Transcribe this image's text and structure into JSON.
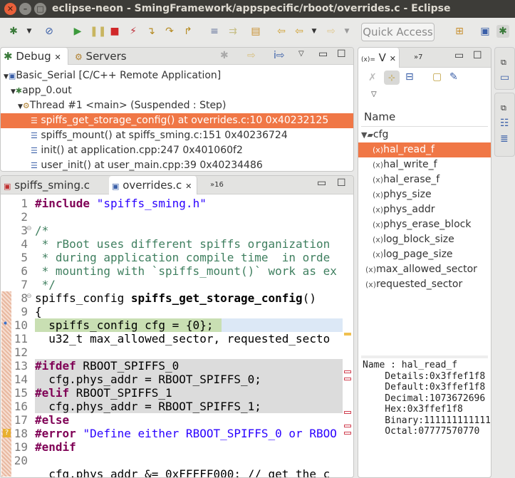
{
  "window": {
    "title": "eclipse-neon - SmingFramework/appspecific/rboot/overrides.c - Eclipse"
  },
  "toolbar": {
    "quick_access": "Quick Access"
  },
  "debug_panel": {
    "tabs": [
      {
        "label": "Debug"
      },
      {
        "label": "Servers"
      }
    ],
    "tree": [
      {
        "label": "Basic_Serial [C/C++ Remote Application]"
      },
      {
        "label": "app_0.out"
      },
      {
        "label": "Thread #1 <main> (Suspended : Step)"
      },
      {
        "label": "spiffs_get_storage_config() at overrides.c:10 0x40232125"
      },
      {
        "label": "spiffs_mount() at spiffs_sming.c:151 0x40236724"
      },
      {
        "label": "init() at application.cpp:247 0x401060f2"
      },
      {
        "label": "user_init() at user_main.cpp:39 0x40234486"
      }
    ]
  },
  "editor": {
    "tabs": [
      {
        "label": "spiffs_sming.c"
      },
      {
        "label": "overrides.c"
      },
      {
        "label": "16"
      }
    ],
    "lines": [
      {
        "n": "1",
        "parts": [
          [
            "kw",
            "#include"
          ],
          [
            "",
            " "
          ],
          [
            "str",
            "\"spiffs_sming.h\""
          ]
        ]
      },
      {
        "n": "2",
        "parts": []
      },
      {
        "n": "3",
        "parts": [
          [
            "cm",
            "/*"
          ]
        ]
      },
      {
        "n": "4",
        "parts": [
          [
            "cm",
            " * rBoot uses different spiffs organization"
          ]
        ]
      },
      {
        "n": "5",
        "parts": [
          [
            "cm",
            " * during application compile time  in orde"
          ]
        ]
      },
      {
        "n": "6",
        "parts": [
          [
            "cm",
            " * mounting with `spiffs_mount()` work as ex"
          ]
        ]
      },
      {
        "n": "7",
        "parts": [
          [
            "cm",
            " */"
          ]
        ]
      },
      {
        "n": "8",
        "parts": [
          [
            "",
            "spiffs_config "
          ],
          [
            "b",
            "spiffs_get_storage_config"
          ],
          [
            "",
            "()"
          ]
        ]
      },
      {
        "n": "9",
        "parts": [
          [
            "",
            "{"
          ]
        ]
      },
      {
        "n": "10",
        "parts": [
          [
            "",
            "  spiffs_config cfg = {0};"
          ]
        ]
      },
      {
        "n": "11",
        "parts": [
          [
            "",
            "  u32_t max_allowed_sector, requested_secto"
          ]
        ]
      },
      {
        "n": "12",
        "parts": []
      },
      {
        "n": "13",
        "parts": [
          [
            "kw",
            "#ifdef"
          ],
          [
            "",
            " RBOOT_SPIFFS_0"
          ]
        ]
      },
      {
        "n": "14",
        "parts": [
          [
            "",
            "  cfg.phys_addr = RBOOT_SPIFFS_0;"
          ]
        ]
      },
      {
        "n": "15",
        "parts": [
          [
            "kw",
            "#elif"
          ],
          [
            "",
            " RBOOT_SPIFFS_1"
          ]
        ]
      },
      {
        "n": "16",
        "parts": [
          [
            "",
            "  cfg.phys_addr = RBOOT_SPIFFS_1;"
          ]
        ]
      },
      {
        "n": "17",
        "parts": [
          [
            "kw",
            "#else"
          ]
        ]
      },
      {
        "n": "18",
        "parts": [
          [
            "kw",
            "#error"
          ],
          [
            "",
            " "
          ],
          [
            "str",
            "\"Define either RBOOT_SPIFFS_0 or RBOO"
          ]
        ]
      },
      {
        "n": "19",
        "parts": [
          [
            "kw",
            "#endif"
          ]
        ]
      },
      {
        "n": "20",
        "parts": []
      },
      {
        "n": "",
        "parts": [
          [
            "",
            "  cfg.phys_addr &= 0xFFFFF000; // get the c"
          ]
        ]
      }
    ]
  },
  "variables_panel": {
    "tab_label": "V",
    "tab_overflow": "7",
    "column_header": "Name",
    "tree": [
      {
        "label": "cfg"
      },
      {
        "label": "hal_read_f"
      },
      {
        "label": "hal_write_f"
      },
      {
        "label": "hal_erase_f"
      },
      {
        "label": "phys_size"
      },
      {
        "label": "phys_addr"
      },
      {
        "label": "phys_erase_block"
      },
      {
        "label": "log_block_size"
      },
      {
        "label": "log_page_size"
      },
      {
        "label": "max_allowed_sector"
      },
      {
        "label": "requested_sector"
      }
    ],
    "details": [
      "Name : hal_read_f",
      "    Details:0x3ffef1f8",
      "    Default:0x3ffef1f8",
      "    Decimal:1073672696",
      "    Hex:0x3ffef1f8",
      "    Binary:111111111111",
      "    Octal:07777570770"
    ]
  },
  "colors": {
    "selection": "#f07746",
    "title_bg": "#3d3c38",
    "current_line": "#c9dfb3",
    "inactive_code": "#dcdcdc"
  }
}
